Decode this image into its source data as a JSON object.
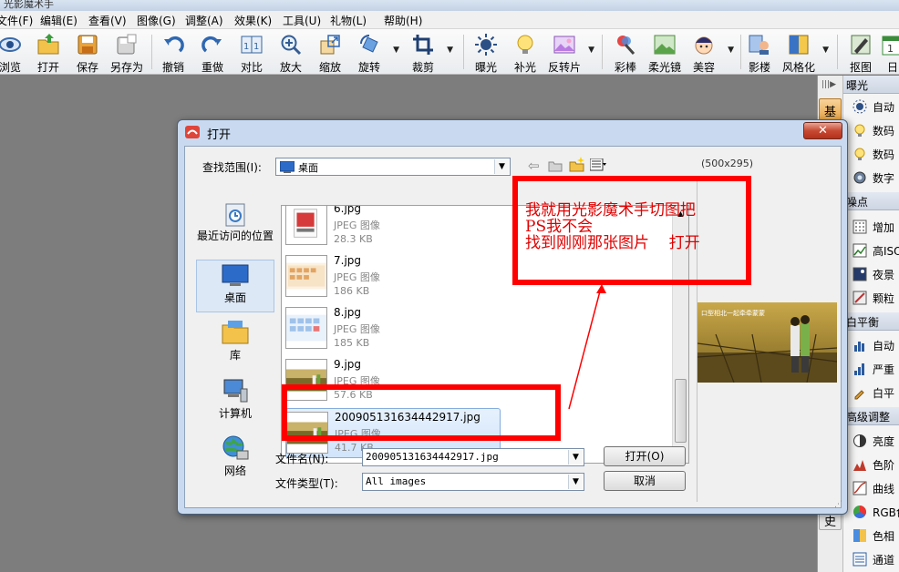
{
  "app": {
    "title": "光影魔术手"
  },
  "menu": [
    "文件(F)",
    "编辑(E)",
    "查看(V)",
    "图像(G)",
    "调整(A)",
    "效果(K)",
    "工具(U)",
    "礼物(L)",
    "帮助(H)"
  ],
  "toolbar": {
    "items": [
      {
        "label": "浏览",
        "icon": "eye-icon"
      },
      {
        "label": "打开",
        "icon": "open-folder-icon"
      },
      {
        "label": "保存",
        "icon": "save-disk-icon"
      },
      {
        "label": "另存为",
        "icon": "save-as-icon"
      },
      {
        "label": "撤销",
        "icon": "undo-icon"
      },
      {
        "label": "重做",
        "icon": "redo-icon"
      },
      {
        "label": "对比",
        "icon": "compare-icon"
      },
      {
        "label": "放大",
        "icon": "zoom-in-icon"
      },
      {
        "label": "缩放",
        "icon": "resize-icon"
      },
      {
        "label": "旋转",
        "icon": "rotate-icon"
      },
      {
        "label": "裁剪",
        "icon": "crop-icon"
      },
      {
        "label": "曝光",
        "icon": "exposure-icon"
      },
      {
        "label": "补光",
        "icon": "fill-light-icon"
      },
      {
        "label": "反转片",
        "icon": "reversal-film-icon"
      },
      {
        "label": "彩棒",
        "icon": "color-wand-icon"
      },
      {
        "label": "柔光镜",
        "icon": "soft-lens-icon"
      },
      {
        "label": "美容",
        "icon": "beauty-face-icon"
      },
      {
        "label": "影楼",
        "icon": "studio-icon"
      },
      {
        "label": "风格化",
        "icon": "stylize-icon"
      },
      {
        "label": "抠图",
        "icon": "cutout-icon"
      },
      {
        "label": "日",
        "icon": "calendar-icon"
      }
    ]
  },
  "right_panel": {
    "tab_label": "基",
    "tab_label_2": "史",
    "sections": [
      {
        "title": "曝光",
        "items": [
          "自动",
          "数码",
          "数码",
          "数字"
        ]
      },
      {
        "title": "噪点",
        "items": [
          "增加",
          "高ISO",
          "夜景",
          "颗粒"
        ]
      },
      {
        "title": "白平衡",
        "items": [
          "自动",
          "严重",
          "白平"
        ]
      },
      {
        "title": "高级调整",
        "items": [
          "亮度",
          "色阶",
          "曲线",
          "RGB色",
          "色相",
          "通道"
        ]
      }
    ]
  },
  "dialog": {
    "title": "打开",
    "close_label": "✕",
    "look_in_label": "查找范围(I):",
    "look_in_value": "桌面",
    "preview_size": "(500x295)",
    "places": [
      "最近访问的位置",
      "桌面",
      "库",
      "计算机",
      "网络"
    ],
    "files": [
      {
        "name": "6.jpg",
        "type": "JPEG 图像",
        "size": "28.3 KB"
      },
      {
        "name": "7.jpg",
        "type": "JPEG 图像",
        "size": "186 KB"
      },
      {
        "name": "8.jpg",
        "type": "JPEG 图像",
        "size": "185 KB"
      },
      {
        "name": "9.jpg",
        "type": "JPEG 图像",
        "size": "57.6 KB"
      },
      {
        "name": "200905131634442917.jpg",
        "type": "JPEG 图像",
        "size": "41.7 KB"
      }
    ],
    "filename_label": "文件名(N):",
    "filename_value": "200905131634442917.jpg",
    "filetype_label": "文件类型(T):",
    "filetype_value": "All images",
    "open_button": "打开(O)",
    "cancel_button": "取消",
    "preview_caption": "口型相北一起牵牵蒙蒙"
  },
  "annotation": {
    "lines": [
      "我就用光影魔术手切图把",
      "PS我不会",
      "找到刚刚那张图片    打开"
    ]
  },
  "colors": {
    "annotation": "#ff0000",
    "dialog_frame": "#c9daf0",
    "workspace": "#7d7d7d"
  }
}
